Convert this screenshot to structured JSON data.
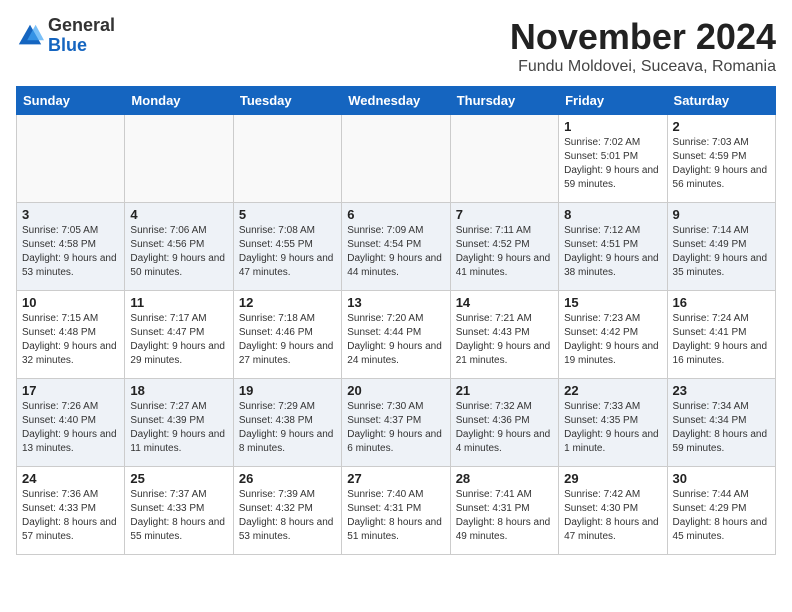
{
  "logo": {
    "general": "General",
    "blue": "Blue"
  },
  "title": "November 2024",
  "location": "Fundu Moldovei, Suceava, Romania",
  "weekdays": [
    "Sunday",
    "Monday",
    "Tuesday",
    "Wednesday",
    "Thursday",
    "Friday",
    "Saturday"
  ],
  "weeks": [
    [
      {
        "day": "",
        "info": ""
      },
      {
        "day": "",
        "info": ""
      },
      {
        "day": "",
        "info": ""
      },
      {
        "day": "",
        "info": ""
      },
      {
        "day": "",
        "info": ""
      },
      {
        "day": "1",
        "info": "Sunrise: 7:02 AM\nSunset: 5:01 PM\nDaylight: 9 hours and 59 minutes."
      },
      {
        "day": "2",
        "info": "Sunrise: 7:03 AM\nSunset: 4:59 PM\nDaylight: 9 hours and 56 minutes."
      }
    ],
    [
      {
        "day": "3",
        "info": "Sunrise: 7:05 AM\nSunset: 4:58 PM\nDaylight: 9 hours and 53 minutes."
      },
      {
        "day": "4",
        "info": "Sunrise: 7:06 AM\nSunset: 4:56 PM\nDaylight: 9 hours and 50 minutes."
      },
      {
        "day": "5",
        "info": "Sunrise: 7:08 AM\nSunset: 4:55 PM\nDaylight: 9 hours and 47 minutes."
      },
      {
        "day": "6",
        "info": "Sunrise: 7:09 AM\nSunset: 4:54 PM\nDaylight: 9 hours and 44 minutes."
      },
      {
        "day": "7",
        "info": "Sunrise: 7:11 AM\nSunset: 4:52 PM\nDaylight: 9 hours and 41 minutes."
      },
      {
        "day": "8",
        "info": "Sunrise: 7:12 AM\nSunset: 4:51 PM\nDaylight: 9 hours and 38 minutes."
      },
      {
        "day": "9",
        "info": "Sunrise: 7:14 AM\nSunset: 4:49 PM\nDaylight: 9 hours and 35 minutes."
      }
    ],
    [
      {
        "day": "10",
        "info": "Sunrise: 7:15 AM\nSunset: 4:48 PM\nDaylight: 9 hours and 32 minutes."
      },
      {
        "day": "11",
        "info": "Sunrise: 7:17 AM\nSunset: 4:47 PM\nDaylight: 9 hours and 29 minutes."
      },
      {
        "day": "12",
        "info": "Sunrise: 7:18 AM\nSunset: 4:46 PM\nDaylight: 9 hours and 27 minutes."
      },
      {
        "day": "13",
        "info": "Sunrise: 7:20 AM\nSunset: 4:44 PM\nDaylight: 9 hours and 24 minutes."
      },
      {
        "day": "14",
        "info": "Sunrise: 7:21 AM\nSunset: 4:43 PM\nDaylight: 9 hours and 21 minutes."
      },
      {
        "day": "15",
        "info": "Sunrise: 7:23 AM\nSunset: 4:42 PM\nDaylight: 9 hours and 19 minutes."
      },
      {
        "day": "16",
        "info": "Sunrise: 7:24 AM\nSunset: 4:41 PM\nDaylight: 9 hours and 16 minutes."
      }
    ],
    [
      {
        "day": "17",
        "info": "Sunrise: 7:26 AM\nSunset: 4:40 PM\nDaylight: 9 hours and 13 minutes."
      },
      {
        "day": "18",
        "info": "Sunrise: 7:27 AM\nSunset: 4:39 PM\nDaylight: 9 hours and 11 minutes."
      },
      {
        "day": "19",
        "info": "Sunrise: 7:29 AM\nSunset: 4:38 PM\nDaylight: 9 hours and 8 minutes."
      },
      {
        "day": "20",
        "info": "Sunrise: 7:30 AM\nSunset: 4:37 PM\nDaylight: 9 hours and 6 minutes."
      },
      {
        "day": "21",
        "info": "Sunrise: 7:32 AM\nSunset: 4:36 PM\nDaylight: 9 hours and 4 minutes."
      },
      {
        "day": "22",
        "info": "Sunrise: 7:33 AM\nSunset: 4:35 PM\nDaylight: 9 hours and 1 minute."
      },
      {
        "day": "23",
        "info": "Sunrise: 7:34 AM\nSunset: 4:34 PM\nDaylight: 8 hours and 59 minutes."
      }
    ],
    [
      {
        "day": "24",
        "info": "Sunrise: 7:36 AM\nSunset: 4:33 PM\nDaylight: 8 hours and 57 minutes."
      },
      {
        "day": "25",
        "info": "Sunrise: 7:37 AM\nSunset: 4:33 PM\nDaylight: 8 hours and 55 minutes."
      },
      {
        "day": "26",
        "info": "Sunrise: 7:39 AM\nSunset: 4:32 PM\nDaylight: 8 hours and 53 minutes."
      },
      {
        "day": "27",
        "info": "Sunrise: 7:40 AM\nSunset: 4:31 PM\nDaylight: 8 hours and 51 minutes."
      },
      {
        "day": "28",
        "info": "Sunrise: 7:41 AM\nSunset: 4:31 PM\nDaylight: 8 hours and 49 minutes."
      },
      {
        "day": "29",
        "info": "Sunrise: 7:42 AM\nSunset: 4:30 PM\nDaylight: 8 hours and 47 minutes."
      },
      {
        "day": "30",
        "info": "Sunrise: 7:44 AM\nSunset: 4:29 PM\nDaylight: 8 hours and 45 minutes."
      }
    ]
  ]
}
